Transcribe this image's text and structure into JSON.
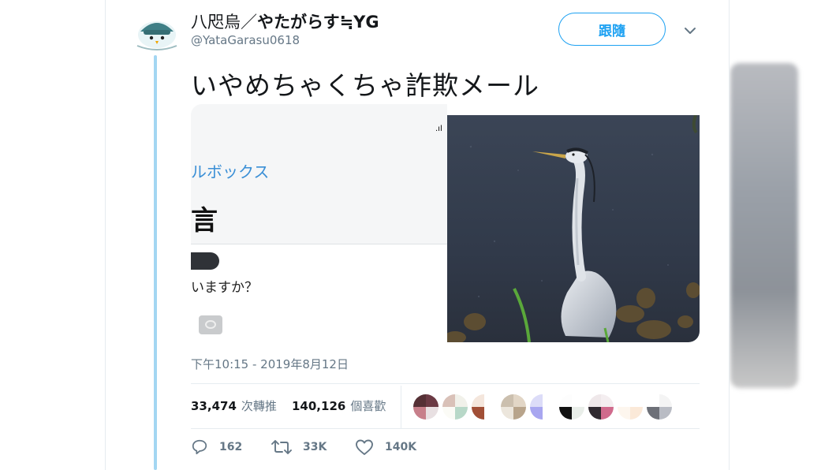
{
  "author": {
    "display_name_prefix": "八咫烏／",
    "display_name_bold": "やたがらす≒YG",
    "handle": "@YataGarasu0618"
  },
  "follow_button_label": "跟隨",
  "tweet_text": "いやめちゃくちゃ詐欺メール",
  "media": {
    "screenshot": {
      "signal_glyph": ".ıl",
      "mailbox_label": "ルボックス",
      "big_char": "言",
      "question_text": "いますか？"
    },
    "photo_icon": "heron-photo"
  },
  "timestamp": "下午10:15 - 2019年8月12日",
  "stats": {
    "retweets_count": "33,474",
    "retweets_label": "次轉推",
    "likes_count": "140,126",
    "likes_label": "個喜歡"
  },
  "liker_avatar_count": 9,
  "actions": {
    "replies": "162",
    "retweets": "33K",
    "likes": "140K"
  },
  "colors": {
    "accent": "#1da1f2",
    "thread_line": "#a3d6f2",
    "muted_text": "#657786"
  }
}
